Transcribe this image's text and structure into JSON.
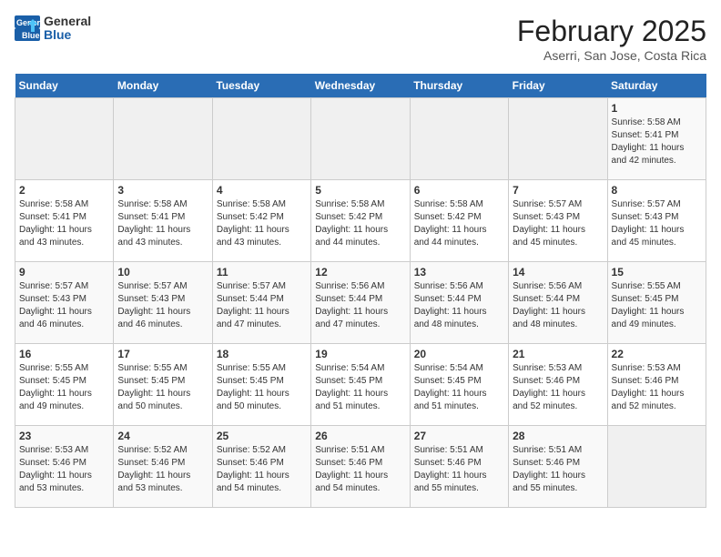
{
  "header": {
    "logo_general": "General",
    "logo_blue": "Blue",
    "month_title": "February 2025",
    "location": "Aserri, San Jose, Costa Rica"
  },
  "days_of_week": [
    "Sunday",
    "Monday",
    "Tuesday",
    "Wednesday",
    "Thursday",
    "Friday",
    "Saturday"
  ],
  "weeks": [
    [
      {
        "day": "",
        "info": ""
      },
      {
        "day": "",
        "info": ""
      },
      {
        "day": "",
        "info": ""
      },
      {
        "day": "",
        "info": ""
      },
      {
        "day": "",
        "info": ""
      },
      {
        "day": "",
        "info": ""
      },
      {
        "day": "1",
        "info": "Sunrise: 5:58 AM\nSunset: 5:41 PM\nDaylight: 11 hours\nand 42 minutes."
      }
    ],
    [
      {
        "day": "2",
        "info": "Sunrise: 5:58 AM\nSunset: 5:41 PM\nDaylight: 11 hours\nand 43 minutes."
      },
      {
        "day": "3",
        "info": "Sunrise: 5:58 AM\nSunset: 5:41 PM\nDaylight: 11 hours\nand 43 minutes."
      },
      {
        "day": "4",
        "info": "Sunrise: 5:58 AM\nSunset: 5:42 PM\nDaylight: 11 hours\nand 43 minutes."
      },
      {
        "day": "5",
        "info": "Sunrise: 5:58 AM\nSunset: 5:42 PM\nDaylight: 11 hours\nand 44 minutes."
      },
      {
        "day": "6",
        "info": "Sunrise: 5:58 AM\nSunset: 5:42 PM\nDaylight: 11 hours\nand 44 minutes."
      },
      {
        "day": "7",
        "info": "Sunrise: 5:57 AM\nSunset: 5:43 PM\nDaylight: 11 hours\nand 45 minutes."
      },
      {
        "day": "8",
        "info": "Sunrise: 5:57 AM\nSunset: 5:43 PM\nDaylight: 11 hours\nand 45 minutes."
      }
    ],
    [
      {
        "day": "9",
        "info": "Sunrise: 5:57 AM\nSunset: 5:43 PM\nDaylight: 11 hours\nand 46 minutes."
      },
      {
        "day": "10",
        "info": "Sunrise: 5:57 AM\nSunset: 5:43 PM\nDaylight: 11 hours\nand 46 minutes."
      },
      {
        "day": "11",
        "info": "Sunrise: 5:57 AM\nSunset: 5:44 PM\nDaylight: 11 hours\nand 47 minutes."
      },
      {
        "day": "12",
        "info": "Sunrise: 5:56 AM\nSunset: 5:44 PM\nDaylight: 11 hours\nand 47 minutes."
      },
      {
        "day": "13",
        "info": "Sunrise: 5:56 AM\nSunset: 5:44 PM\nDaylight: 11 hours\nand 48 minutes."
      },
      {
        "day": "14",
        "info": "Sunrise: 5:56 AM\nSunset: 5:44 PM\nDaylight: 11 hours\nand 48 minutes."
      },
      {
        "day": "15",
        "info": "Sunrise: 5:55 AM\nSunset: 5:45 PM\nDaylight: 11 hours\nand 49 minutes."
      }
    ],
    [
      {
        "day": "16",
        "info": "Sunrise: 5:55 AM\nSunset: 5:45 PM\nDaylight: 11 hours\nand 49 minutes."
      },
      {
        "day": "17",
        "info": "Sunrise: 5:55 AM\nSunset: 5:45 PM\nDaylight: 11 hours\nand 50 minutes."
      },
      {
        "day": "18",
        "info": "Sunrise: 5:55 AM\nSunset: 5:45 PM\nDaylight: 11 hours\nand 50 minutes."
      },
      {
        "day": "19",
        "info": "Sunrise: 5:54 AM\nSunset: 5:45 PM\nDaylight: 11 hours\nand 51 minutes."
      },
      {
        "day": "20",
        "info": "Sunrise: 5:54 AM\nSunset: 5:45 PM\nDaylight: 11 hours\nand 51 minutes."
      },
      {
        "day": "21",
        "info": "Sunrise: 5:53 AM\nSunset: 5:46 PM\nDaylight: 11 hours\nand 52 minutes."
      },
      {
        "day": "22",
        "info": "Sunrise: 5:53 AM\nSunset: 5:46 PM\nDaylight: 11 hours\nand 52 minutes."
      }
    ],
    [
      {
        "day": "23",
        "info": "Sunrise: 5:53 AM\nSunset: 5:46 PM\nDaylight: 11 hours\nand 53 minutes."
      },
      {
        "day": "24",
        "info": "Sunrise: 5:52 AM\nSunset: 5:46 PM\nDaylight: 11 hours\nand 53 minutes."
      },
      {
        "day": "25",
        "info": "Sunrise: 5:52 AM\nSunset: 5:46 PM\nDaylight: 11 hours\nand 54 minutes."
      },
      {
        "day": "26",
        "info": "Sunrise: 5:51 AM\nSunset: 5:46 PM\nDaylight: 11 hours\nand 54 minutes."
      },
      {
        "day": "27",
        "info": "Sunrise: 5:51 AM\nSunset: 5:46 PM\nDaylight: 11 hours\nand 55 minutes."
      },
      {
        "day": "28",
        "info": "Sunrise: 5:51 AM\nSunset: 5:46 PM\nDaylight: 11 hours\nand 55 minutes."
      },
      {
        "day": "",
        "info": ""
      }
    ]
  ]
}
